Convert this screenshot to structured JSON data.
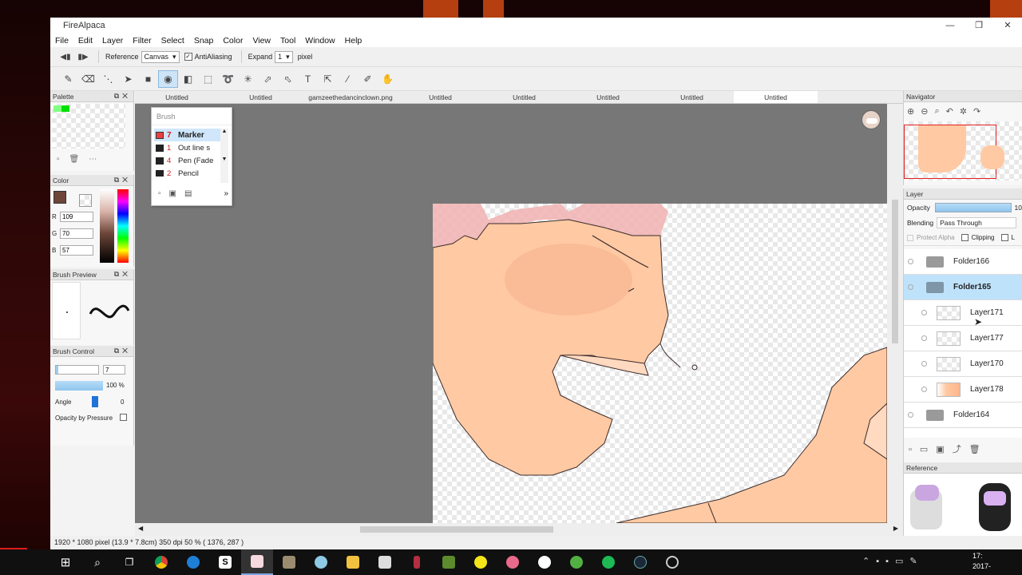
{
  "window": {
    "title": "FireAlpaca",
    "min_icon": "minimize-icon",
    "max_icon": "maximize-icon",
    "close_icon": "close-icon"
  },
  "menu": [
    "File",
    "Edit",
    "Layer",
    "Filter",
    "Select",
    "Snap",
    "Color",
    "View",
    "Tool",
    "Window",
    "Help"
  ],
  "options": {
    "reference_label": "Reference",
    "reference_value": "Canvas",
    "antialiasing_label": "AntiAliasing",
    "expand_label": "Expand",
    "expand_value": "1",
    "unit_label": "pixel"
  },
  "tabs": [
    "Untitled",
    "Untitled",
    "gamzeethedancinclown.png",
    "Untitled",
    "Untitled",
    "Untitled",
    "Untitled",
    "Untitled"
  ],
  "active_tab_index": 7,
  "panels": {
    "palette": "Palette",
    "color": "Color",
    "color_rgb": {
      "r_label": "R",
      "r": "109",
      "g_label": "G",
      "g": "70",
      "b_label": "B",
      "b": "57"
    },
    "brush_preview": "Brush Preview",
    "brush_control": "Brush Control",
    "brush_size": "7",
    "brush_opacity": "100 %",
    "angle_label": "Angle",
    "angle_value": "0",
    "opacity_pressure_label": "Opacity by Pressure"
  },
  "brush_popup": {
    "title": "Brush",
    "items": [
      {
        "size": "7",
        "name": "Marker"
      },
      {
        "size": "1",
        "name": "Out line s"
      },
      {
        "size": "4",
        "name": "Pen (Fade"
      },
      {
        "size": "2",
        "name": "Pencil"
      }
    ],
    "more_label": "»"
  },
  "navigator": {
    "title": "Navigator"
  },
  "layer_panel": {
    "title": "Layer",
    "opacity_label": "Opacity",
    "opacity_value": "10",
    "blending_label": "Blending",
    "blending_value": "Pass Through",
    "protect_alpha_label": "Protect Alpha",
    "clipping_label": "Clipping",
    "lock_label": "L",
    "layers": [
      {
        "name": "Folder166",
        "type": "folder"
      },
      {
        "name": "Folder165",
        "type": "folder",
        "selected": true
      },
      {
        "name": "Layer171",
        "type": "layer"
      },
      {
        "name": "Layer177",
        "type": "layer"
      },
      {
        "name": "Layer170",
        "type": "layer"
      },
      {
        "name": "Layer178",
        "type": "layer"
      },
      {
        "name": "Folder164",
        "type": "folder"
      }
    ]
  },
  "reference_panel": {
    "title": "Reference"
  },
  "status": "1920 * 1080 pixel   (13.9 * 7.8cm)   350 dpi   50 %   ( 1376, 287 )",
  "taskbar": {
    "clock_time": "17:",
    "clock_date": "2017-",
    "apps": [
      "start-icon",
      "search-icon",
      "task-view-icon",
      "chrome-icon",
      "edge-icon",
      "skype-icon",
      "firealpaca-icon",
      "app-icon",
      "app-icon",
      "file-explorer-icon",
      "store-icon",
      "app-icon",
      "minecraft-icon",
      "app-icon",
      "app-icon",
      "app-icon",
      "app-icon",
      "spotify-icon",
      "steam-icon",
      "app-icon"
    ]
  },
  "colors": {
    "main_color": "#6d4639",
    "skin": "#ffc9a3",
    "hair": "#f0b2b0"
  }
}
